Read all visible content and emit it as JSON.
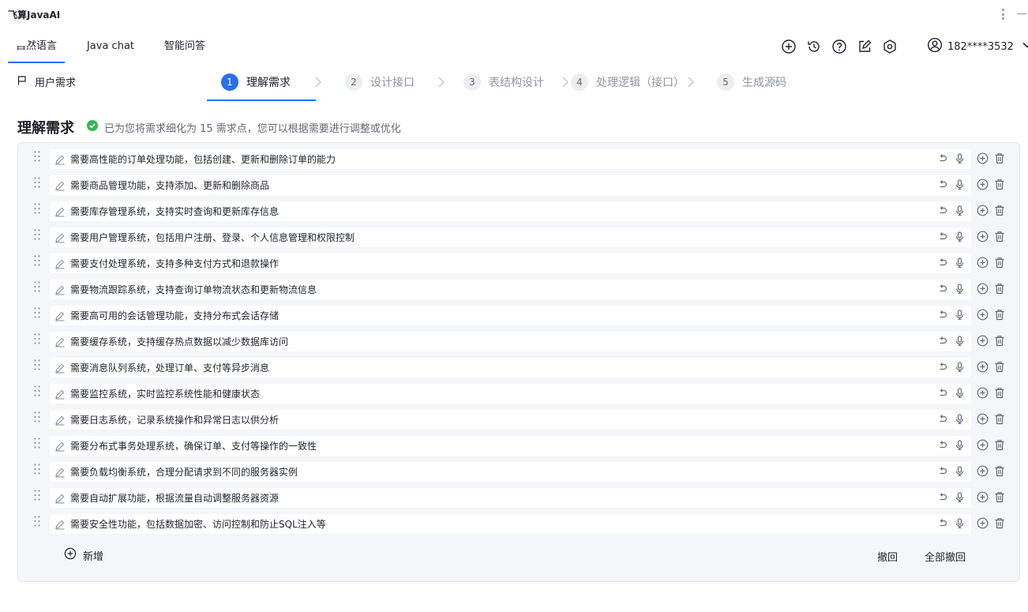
{
  "app": {
    "title": "飞算JavaAI"
  },
  "tabs": [
    {
      "label": "自然语言",
      "active": true
    },
    {
      "label": "Java chat",
      "active": false
    },
    {
      "label": "智能问答",
      "active": false
    }
  ],
  "toolbar_icons": [
    "add-circle-icon",
    "history-icon",
    "help-icon",
    "edit-icon",
    "settings-icon"
  ],
  "user": {
    "name": "182****3532"
  },
  "nav": {
    "requirement_label": "用户需求"
  },
  "steps": [
    {
      "num": "1",
      "label": "理解需求",
      "active": true
    },
    {
      "num": "2",
      "label": "设计接口",
      "active": false
    },
    {
      "num": "3",
      "label": "表结构设计",
      "active": false
    },
    {
      "num": "4",
      "label": "处理逻辑（接口）",
      "active": false
    },
    {
      "num": "5",
      "label": "生成源码",
      "active": false
    }
  ],
  "section": {
    "title": "理解需求",
    "subtitle": "已为您将需求细化为 15 需求点，您可以根据需要进行调整或优化"
  },
  "requirements": [
    "需要高性能的订单处理功能，包括创建、更新和删除订单的能力",
    "需要商品管理功能，支持添加、更新和删除商品",
    "需要库存管理系统，支持实时查询和更新库存信息",
    "需要用户管理系统，包括用户注册、登录、个人信息管理和权限控制",
    "需要支付处理系统，支持多种支付方式和退款操作",
    "需要物流跟踪系统，支持查询订单物流状态和更新物流信息",
    "需要高可用的会话管理功能，支持分布式会话存储",
    "需要缓存系统，支持缓存热点数据以减少数据库访问",
    "需要消息队列系统，处理订单、支付等异步消息",
    "需要监控系统，实时监控系统性能和健康状态",
    "需要日志系统，记录系统操作和异常日志以供分析",
    "需要分布式事务处理系统，确保订单、支付等操作的一致性",
    "需要负载均衡系统，合理分配请求到不同的服务器实例",
    "需要自动扩展功能，根据流量自动调整服务器资源",
    "需要安全性功能，包括数据加密、访问控制和防止SQL注入等"
  ],
  "footer": {
    "add_label": "新增",
    "undo_label": "撤回",
    "undo_all_label": "全部撤回"
  },
  "colors": {
    "accent": "#2a6ef0",
    "success": "#34b852",
    "panel_bg": "#f5f6f7"
  }
}
